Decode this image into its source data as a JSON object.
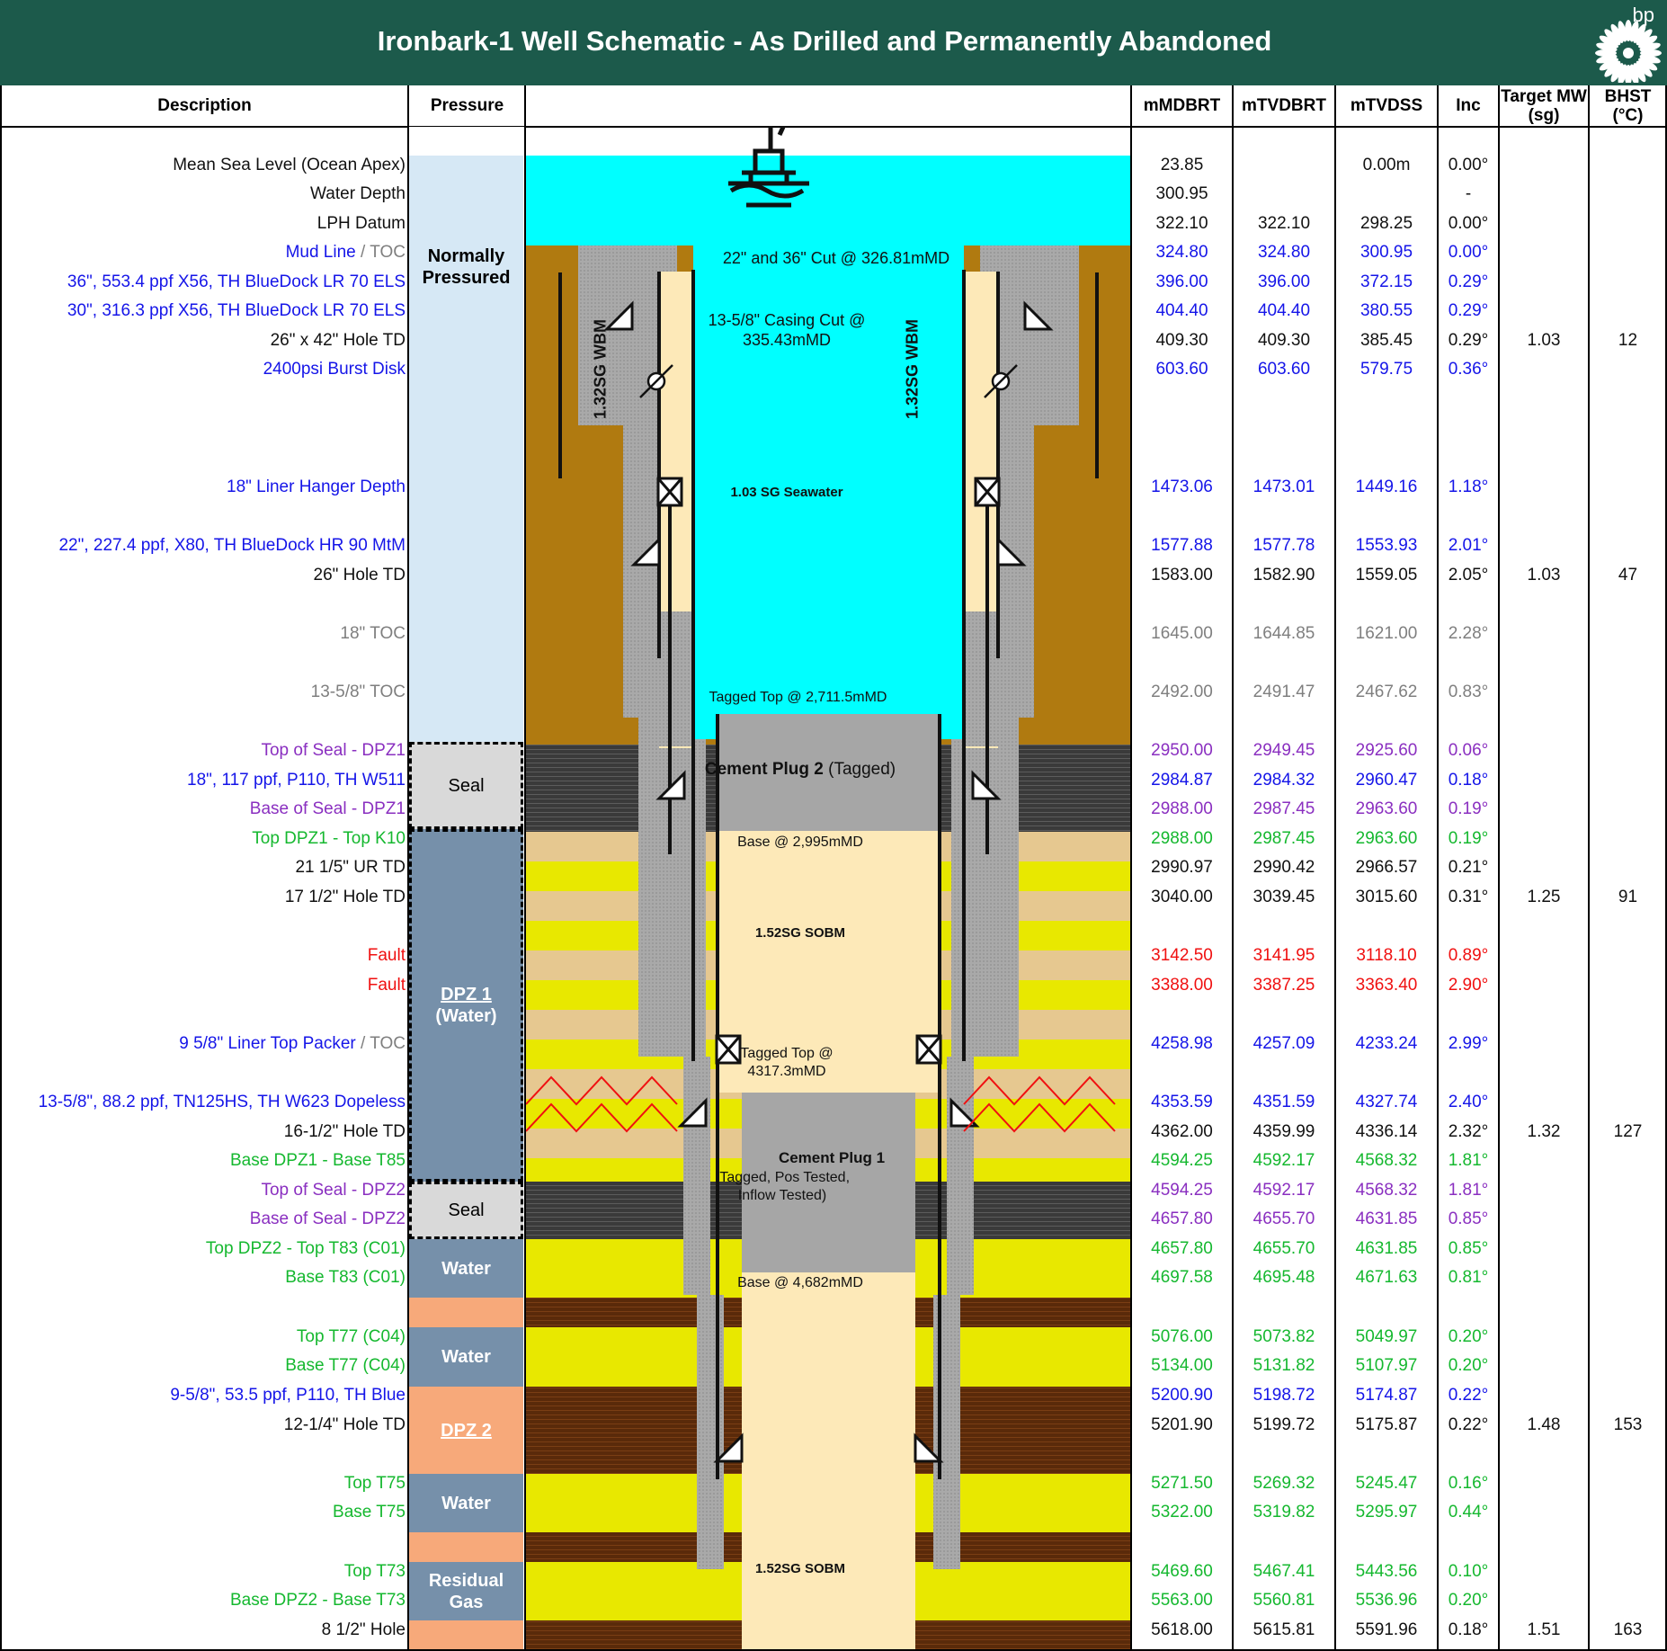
{
  "title": "Ironbark-1 Well Schematic - As Drilled and Permanently Abandoned",
  "brand": "bp",
  "headers": {
    "description": "Description",
    "pressure": "Pressure",
    "md": "mMDBRT",
    "tvd": "mTVDBRT",
    "tvdss": "mTVDSS",
    "inc": "Inc",
    "mw": "Target MW (sg)",
    "bhst": "BHST (°C)"
  },
  "rows": [
    {
      "d": "Mean Sea Level (Ocean Apex)",
      "c": "black",
      "md": "23.85",
      "tvd": "",
      "tvdss": "0.00m",
      "inc": "0.00°",
      "mw": "",
      "bhst": ""
    },
    {
      "d": "Water Depth",
      "c": "black",
      "md": "300.95",
      "tvd": "",
      "tvdss": "",
      "inc": "-",
      "mw": "",
      "bhst": ""
    },
    {
      "d": "LPH Datum",
      "c": "black",
      "md": "322.10",
      "tvd": "322.10",
      "tvdss": "298.25",
      "inc": "0.00°",
      "mw": "",
      "bhst": ""
    },
    {
      "d": "Mud Line",
      "d2": " / TOC",
      "c": "blue",
      "md": "324.80",
      "tvd": "324.80",
      "tvdss": "300.95",
      "inc": "0.00°",
      "mw": "",
      "bhst": ""
    },
    {
      "d": "36\", 553.4 ppf X56, TH BlueDock LR 70 ELS",
      "c": "blue",
      "md": "396.00",
      "tvd": "396.00",
      "tvdss": "372.15",
      "inc": "0.29°",
      "mw": "",
      "bhst": ""
    },
    {
      "d": "30\", 316.3 ppf X56, TH BlueDock LR 70 ELS",
      "c": "blue",
      "md": "404.40",
      "tvd": "404.40",
      "tvdss": "380.55",
      "inc": "0.29°",
      "mw": "",
      "bhst": ""
    },
    {
      "d": "26\" x 42\" Hole TD",
      "c": "black",
      "md": "409.30",
      "tvd": "409.30",
      "tvdss": "385.45",
      "inc": "0.29°",
      "mw": "1.03",
      "bhst": "12"
    },
    {
      "d": "2400psi Burst Disk",
      "c": "blue",
      "md": "603.60",
      "tvd": "603.60",
      "tvdss": "579.75",
      "inc": "0.36°",
      "mw": "",
      "bhst": ""
    },
    {
      "d": "18\" Liner Hanger Depth",
      "c": "blue",
      "md": "1473.06",
      "tvd": "1473.01",
      "tvdss": "1449.16",
      "inc": "1.18°",
      "mw": "",
      "bhst": ""
    },
    {
      "d": "22\", 227.4 ppf, X80, TH BlueDock HR 90 MtM",
      "c": "blue",
      "md": "1577.88",
      "tvd": "1577.78",
      "tvdss": "1553.93",
      "inc": "2.01°",
      "mw": "",
      "bhst": ""
    },
    {
      "d": "26\" Hole TD",
      "c": "black",
      "md": "1583.00",
      "tvd": "1582.90",
      "tvdss": "1559.05",
      "inc": "2.05°",
      "mw": "1.03",
      "bhst": "47"
    },
    {
      "d": "18\" TOC",
      "c": "gray",
      "md": "1645.00",
      "tvd": "1644.85",
      "tvdss": "1621.00",
      "inc": "2.28°",
      "mw": "",
      "bhst": ""
    },
    {
      "d": "13-5/8\" TOC",
      "c": "gray",
      "md": "2492.00",
      "tvd": "2491.47",
      "tvdss": "2467.62",
      "inc": "0.83°",
      "mw": "",
      "bhst": ""
    },
    {
      "d": "Top of Seal - DPZ1",
      "c": "purple",
      "md": "2950.00",
      "tvd": "2949.45",
      "tvdss": "2925.60",
      "inc": "0.06°",
      "mw": "",
      "bhst": ""
    },
    {
      "d": "18\", 117 ppf, P110, TH W511",
      "c": "blue",
      "md": "2984.87",
      "tvd": "2984.32",
      "tvdss": "2960.47",
      "inc": "0.18°",
      "mw": "",
      "bhst": ""
    },
    {
      "d": "Base of Seal - DPZ1",
      "c": "purple",
      "md": "2988.00",
      "tvd": "2987.45",
      "tvdss": "2963.60",
      "inc": "0.19°",
      "mw": "",
      "bhst": ""
    },
    {
      "d": "Top DPZ1 - Top K10",
      "c": "green",
      "md": "2988.00",
      "tvd": "2987.45",
      "tvdss": "2963.60",
      "inc": "0.19°",
      "mw": "",
      "bhst": ""
    },
    {
      "d": "21 1/5\" UR TD",
      "c": "black",
      "md": "2990.97",
      "tvd": "2990.42",
      "tvdss": "2966.57",
      "inc": "0.21°",
      "mw": "",
      "bhst": ""
    },
    {
      "d": "17 1/2\" Hole TD",
      "c": "black",
      "md": "3040.00",
      "tvd": "3039.45",
      "tvdss": "3015.60",
      "inc": "0.31°",
      "mw": "1.25",
      "bhst": "91"
    },
    {
      "d": "Fault",
      "c": "red",
      "md": "3142.50",
      "tvd": "3141.95",
      "tvdss": "3118.10",
      "inc": "0.89°",
      "mw": "",
      "bhst": ""
    },
    {
      "d": "Fault",
      "c": "red",
      "md": "3388.00",
      "tvd": "3387.25",
      "tvdss": "3363.40",
      "inc": "2.90°",
      "mw": "",
      "bhst": ""
    },
    {
      "d": "9 5/8\" Liner Top Packer",
      "d2": " / TOC",
      "c": "blue",
      "md": "4258.98",
      "tvd": "4257.09",
      "tvdss": "4233.24",
      "inc": "2.99°",
      "mw": "",
      "bhst": ""
    },
    {
      "d": "13-5/8\", 88.2 ppf, TN125HS, TH W623 Dopeless",
      "c": "blue",
      "md": "4353.59",
      "tvd": "4351.59",
      "tvdss": "4327.74",
      "inc": "2.40°",
      "mw": "",
      "bhst": ""
    },
    {
      "d": "16-1/2\" Hole TD",
      "c": "black",
      "md": "4362.00",
      "tvd": "4359.99",
      "tvdss": "4336.14",
      "inc": "2.32°",
      "mw": "1.32",
      "bhst": "127"
    },
    {
      "d": "Base DPZ1 - Base T85",
      "c": "green",
      "md": "4594.25",
      "tvd": "4592.17",
      "tvdss": "4568.32",
      "inc": "1.81°",
      "mw": "",
      "bhst": ""
    },
    {
      "d": "Top of Seal - DPZ2",
      "c": "purple",
      "md": "4594.25",
      "tvd": "4592.17",
      "tvdss": "4568.32",
      "inc": "1.81°",
      "mw": "",
      "bhst": ""
    },
    {
      "d": "Base of Seal - DPZ2",
      "c": "purple",
      "md": "4657.80",
      "tvd": "4655.70",
      "tvdss": "4631.85",
      "inc": "0.85°",
      "mw": "",
      "bhst": ""
    },
    {
      "d": "Top DPZ2 - Top T83 (C01)",
      "c": "green",
      "md": "4657.80",
      "tvd": "4655.70",
      "tvdss": "4631.85",
      "inc": "0.85°",
      "mw": "",
      "bhst": ""
    },
    {
      "d": "Base T83 (C01)",
      "c": "green",
      "md": "4697.58",
      "tvd": "4695.48",
      "tvdss": "4671.63",
      "inc": "0.81°",
      "mw": "",
      "bhst": ""
    },
    {
      "d": "Top T77 (C04)",
      "c": "green",
      "md": "5076.00",
      "tvd": "5073.82",
      "tvdss": "5049.97",
      "inc": "0.20°",
      "mw": "",
      "bhst": ""
    },
    {
      "d": "Base T77 (C04)",
      "c": "green",
      "md": "5134.00",
      "tvd": "5131.82",
      "tvdss": "5107.97",
      "inc": "0.20°",
      "mw": "",
      "bhst": ""
    },
    {
      "d": "9-5/8\", 53.5 ppf, P110, TH Blue",
      "c": "blue",
      "md": "5200.90",
      "tvd": "5198.72",
      "tvdss": "5174.87",
      "inc": "0.22°",
      "mw": "",
      "bhst": ""
    },
    {
      "d": "12-1/4\" Hole TD",
      "c": "black",
      "md": "5201.90",
      "tvd": "5199.72",
      "tvdss": "5175.87",
      "inc": "0.22°",
      "mw": "1.48",
      "bhst": "153"
    },
    {
      "d": "Top T75",
      "c": "green",
      "md": "5271.50",
      "tvd": "5269.32",
      "tvdss": "5245.47",
      "inc": "0.16°",
      "mw": "",
      "bhst": ""
    },
    {
      "d": "Base T75",
      "c": "green",
      "md": "5322.00",
      "tvd": "5319.82",
      "tvdss": "5295.97",
      "inc": "0.44°",
      "mw": "",
      "bhst": ""
    },
    {
      "d": "Top T73",
      "c": "green",
      "md": "5469.60",
      "tvd": "5467.41",
      "tvdss": "5443.56",
      "inc": "0.10°",
      "mw": "",
      "bhst": ""
    },
    {
      "d": "Base DPZ2 - Base T73",
      "c": "green",
      "md": "5563.00",
      "tvd": "5560.81",
      "tvdss": "5536.96",
      "inc": "0.20°",
      "mw": "",
      "bhst": ""
    },
    {
      "d": "8 1/2\" Hole",
      "c": "black",
      "md": "5618.00",
      "tvd": "5615.81",
      "tvdss": "5591.96",
      "inc": "0.18°",
      "mw": "1.51",
      "bhst": "163"
    }
  ],
  "pressure_zones": {
    "normal": "Normally Pressured",
    "seal1": "Seal",
    "dpz1": "DPZ 1",
    "dpz1_sub": "(Water)",
    "seal2": "Seal",
    "water1": "Water",
    "water2": "Water",
    "dpz2": "DPZ 2",
    "water3": "Water",
    "gas": "Residual Gas"
  },
  "labels": {
    "cut_22_36": "22\" and 36\" Cut @ 326.81mMD",
    "casing_cut": "13-5/8\" Casing Cut @ 335.43mMD",
    "seawater": "1.03 SG Seawater",
    "wbm_left": "1.32SG WBM",
    "wbm_right": "1.32SG WBM",
    "tagged_top_2": "Tagged Top @ 2,711.5mMD",
    "plug2": "Cement Plug 2",
    "plug2_sub": " (Tagged)",
    "base_2995": "Base @ 2,995mMD",
    "sobm_upper": "1.52SG SOBM",
    "tagged_top_1": "Tagged Top @ 4317.3mMD",
    "plug1": "Cement Plug 1",
    "plug1_sub": "(Tagged, Pos Tested, Inflow Tested)",
    "base_4682": "Base @ 4,682mMD",
    "sobm_lower": "1.52SG SOBM"
  },
  "colors": {
    "title_bg": "#1c5a4b",
    "seawater": "#00ffff",
    "formation_brown": "#b07a10",
    "cement_gray": "#a6a6a6",
    "mud_cream": "#fde9b8",
    "seal_dark": "#3a3a3a",
    "sand_yellow": "#e8e800",
    "shale_dark": "#5a2a0a",
    "pressure_normal": "#d6e8f5",
    "pressure_seal": "#d9d9d9",
    "pressure_water": "#7690aa",
    "pressure_dpz2": "#f7a97a"
  },
  "icons": {
    "rig": "offshore-rig-icon",
    "logo": "bp-helios-logo"
  }
}
